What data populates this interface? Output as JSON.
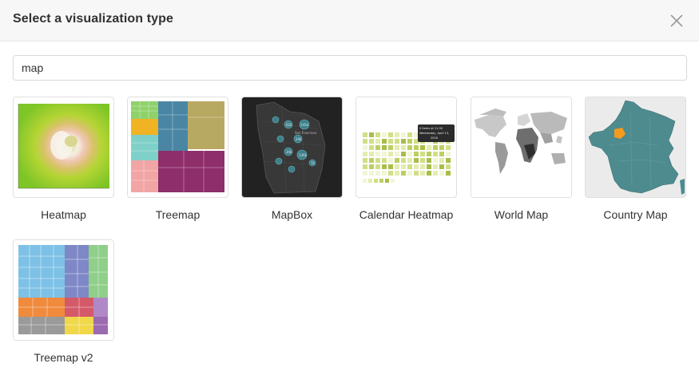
{
  "modal": {
    "title": "Select a visualization type",
    "close_icon": "close-icon"
  },
  "search": {
    "value": "map"
  },
  "tiles": [
    {
      "label": "Heatmap"
    },
    {
      "label": "Treemap"
    },
    {
      "label": "MapBox"
    },
    {
      "label": "Calendar Heatmap"
    },
    {
      "label": "World Map"
    },
    {
      "label": "Country Map"
    },
    {
      "label": "Treemap v2"
    }
  ],
  "thumb_text": {
    "mapbox_city": "San Francisco",
    "mapbox_counts": [
      "62k",
      "145k",
      "24k",
      "136k",
      "34k",
      "7k"
    ],
    "calendar_tooltip": [
      "0 Items at 11:30",
      "Wednesday, April 13,",
      "2016"
    ]
  },
  "colors": {
    "header_bg": "#f7f7f7",
    "border": "#e0e0e0",
    "country_map_fill": "#4e8b8f",
    "country_map_highlight": "#f59b1d"
  }
}
